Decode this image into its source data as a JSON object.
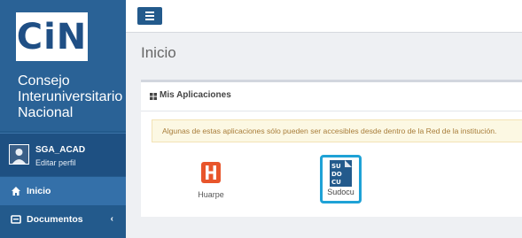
{
  "sidebar": {
    "logo_text": "CiN",
    "org_line1": "Consejo",
    "org_line2": "Interuniversitario",
    "org_line3": "Nacional",
    "user": {
      "name": "SGA_ACAD",
      "edit_label": "Editar perfil"
    },
    "nav": [
      {
        "label": "Inicio",
        "icon": "home-icon",
        "active": true
      },
      {
        "label": "Documentos",
        "icon": "folder-icon",
        "chevron": "‹"
      }
    ]
  },
  "header": {
    "menu_icon": "hamburger-icon"
  },
  "main": {
    "page_title": "Inicio",
    "panel_title": "Mis Aplicaciones",
    "panel_icon": "grid-icon",
    "alert": "Algunas de estas aplicaciones sólo pueden ser accesibles desde dentro de la Red de la institución.",
    "apps": [
      {
        "label": "Huarpe",
        "icon": "huarpe-logo-icon",
        "color": "#e8552b"
      },
      {
        "label": "Sudocu",
        "icon": "sudocu-logo-icon",
        "color": "#235a8c",
        "selected": true
      }
    ]
  },
  "colors": {
    "sidebar": "#235a8c",
    "active_nav": "#3470a9",
    "alert_bg": "#fcf8e3",
    "selection": "#1fa2d6"
  }
}
